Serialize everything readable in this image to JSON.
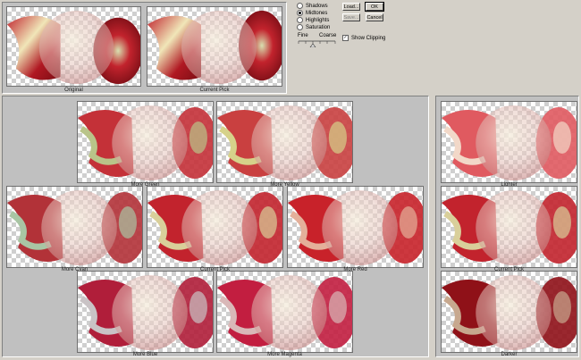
{
  "top": {
    "original_label": "Original",
    "current_pick_label": "Current Pick"
  },
  "tone": {
    "options": [
      "Shadows",
      "Midtones",
      "Highlights",
      "Saturation"
    ],
    "selected": "Midtones"
  },
  "slider": {
    "fine_label": "Fine",
    "coarse_label": "Coarse"
  },
  "show_clipping": {
    "label": "Show Clipping",
    "checked": true
  },
  "buttons": {
    "load": "Load...",
    "save": "Save...",
    "ok": "OK",
    "cancel": "Cancel"
  },
  "variations": {
    "more_green": "More Green",
    "more_yellow": "More Yellow",
    "more_cyan": "More Cyan",
    "current_pick": "Current Pick",
    "more_red": "More Red",
    "more_blue": "More Blue",
    "more_magenta": "More Magenta"
  },
  "brightness": {
    "lighter": "Lighter",
    "current_pick": "Current Pick",
    "darker": "Darker"
  },
  "colors": {
    "panel_bg": "#c0c0c0",
    "window_bg": "#d4d0c8"
  }
}
